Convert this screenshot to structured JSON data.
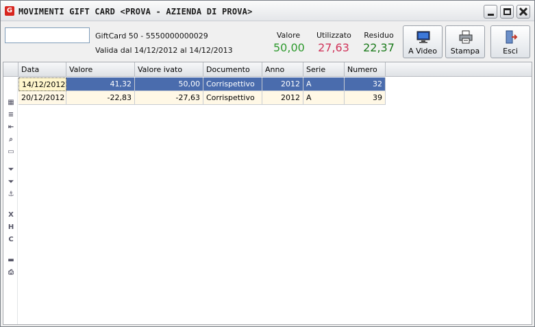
{
  "window": {
    "title": "MOVIMENTI GIFT CARD <PROVA - AZIENDA DI PROVA>",
    "app_icon_letter": "G"
  },
  "header": {
    "code_input_value": "",
    "card_name": "GiftCard 50 - 5550000000029",
    "card_validity": "Valida dal 14/12/2012 al 14/12/2013",
    "stats": {
      "valore": {
        "label": "Valore",
        "value": "50,00",
        "color": "#2e9a2e"
      },
      "utilizzato": {
        "label": "Utilizzato",
        "value": "27,63",
        "color": "#d0335a"
      },
      "residuo": {
        "label": "Residuo",
        "value": "22,37",
        "color": "#1a7a1a"
      }
    },
    "buttons": {
      "video": "A Video",
      "stampa": "Stampa",
      "esci": "Esci"
    }
  },
  "left_toolbar": [
    "grid-layout-icon",
    "list-icon",
    "import-icon",
    "search-icon",
    "columns-icon",
    "filter-add-icon",
    "filter-icon",
    "anchor-icon",
    "export-xls-icon",
    "export-html-icon",
    "export-csv-icon",
    "screen-icon",
    "print-icon"
  ],
  "table": {
    "columns": [
      "Data",
      "Valore",
      "Valore ivato",
      "Documento",
      "Anno",
      "Serie",
      "Numero"
    ],
    "rows": [
      {
        "data": "14/12/2012",
        "valore": "41,32",
        "valore_ivato": "50,00",
        "documento": "Corrispettivo",
        "anno": "2012",
        "serie": "A",
        "numero": "32"
      },
      {
        "data": "20/12/2012",
        "valore": "-22,83",
        "valore_ivato": "-27,63",
        "documento": "Corrispettivo",
        "anno": "2012",
        "serie": "A",
        "numero": "39"
      }
    ]
  }
}
